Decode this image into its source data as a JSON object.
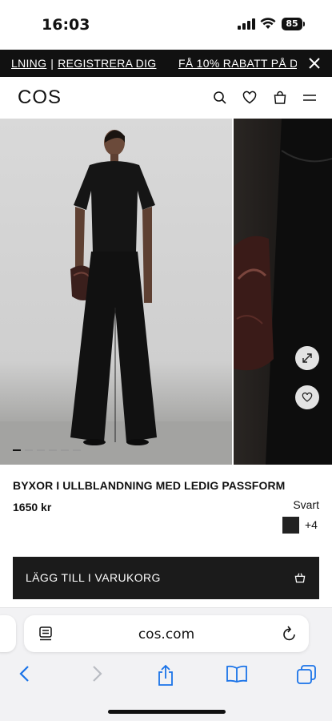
{
  "status_bar": {
    "time": "16:03",
    "battery": "85"
  },
  "promo": {
    "link_login_partial": "LNING",
    "separator": "|",
    "link_register": "REGISTRERA DIG",
    "offer_partial": "FÅ 10% RABATT PÅ D"
  },
  "header": {
    "logo": "COS",
    "icons": [
      "search-icon",
      "heart-icon",
      "bag-icon",
      "menu-icon"
    ]
  },
  "gallery": {
    "image_count": 6,
    "active_index": 0,
    "controls": [
      "expand-icon",
      "heart-icon"
    ]
  },
  "product": {
    "title": "BYXOR I ULLBLANDNING MED LEDIG PASSFORM",
    "price": "1650 kr",
    "colour_name": "Svart",
    "swatch_color": "#222222",
    "more_colours": "+4"
  },
  "cta": {
    "add_to_cart": "LÄGG TILL I VARUKORG"
  },
  "browser": {
    "url": "cos.com",
    "toolbar": [
      "back-icon",
      "forward-icon",
      "share-icon",
      "bookmarks-icon",
      "tabs-icon"
    ],
    "accent": "#1a73e8"
  }
}
